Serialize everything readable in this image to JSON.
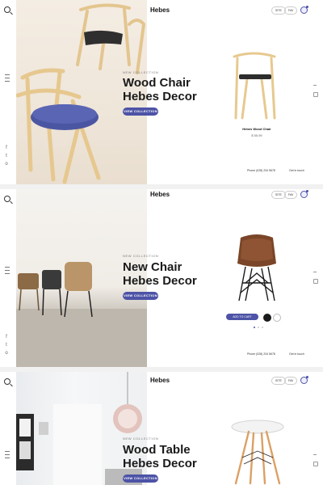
{
  "brand": "Hebes",
  "top_buttons": [
    "SITE",
    "FAV"
  ],
  "sections": [
    {
      "kicker": "NEW COLLECTION",
      "headline_line1": "Wood Chair",
      "headline_line2": "Hebes Decor",
      "cta": "VIEW COLLECTION",
      "product_name": "Hebes Wood Chair",
      "product_price": "$ 55.99",
      "phone": "Phone (028) 234 5678",
      "email": "Get in touch"
    },
    {
      "kicker": "NEW COLLECTION",
      "headline_line1": "New Chair",
      "headline_line2": "Hebes Decor",
      "cta": "VIEW COLLECTION",
      "add_to_cart": "ADD TO CART",
      "phone": "Phone (028) 234 5678",
      "email": "Get in touch"
    },
    {
      "kicker": "NEW COLLECTION",
      "headline_line1": "Wood Table",
      "headline_line2": "Hebes Decor",
      "cta": "VIEW COLLECTION"
    }
  ],
  "colors": {
    "accent": "#4d53a6",
    "wood": "#e8c98e",
    "text": "#1a1a1a"
  },
  "icons": [
    "search-icon",
    "menu-icon",
    "cart-icon",
    "social-icons"
  ]
}
